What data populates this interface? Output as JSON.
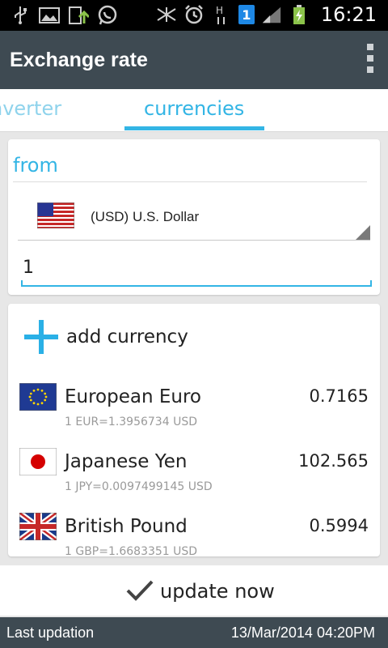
{
  "status_bar": {
    "time": "16:21",
    "sim_badge": "1",
    "icons": [
      "usb-icon",
      "image-icon",
      "upload-icon",
      "whatsapp-icon",
      "mute-icon",
      "alarm-icon",
      "network-h-icon",
      "sim-1-icon",
      "signal-icon",
      "battery-charging-icon"
    ]
  },
  "action_bar": {
    "title": "Exchange rate",
    "overflow_icon": "overflow-menu-icon"
  },
  "tabs": [
    {
      "label": "nverter",
      "selected": false
    },
    {
      "label": "currencies",
      "selected": true
    }
  ],
  "from_card": {
    "label": "from",
    "selected_currency": "(USD) U.S. Dollar",
    "amount": "1"
  },
  "list": {
    "add_label": "add currency",
    "currencies": [
      {
        "name": "European Euro",
        "rate": "1 EUR=1.3956734 USD",
        "value": "0.7165",
        "flag": "eu-flag"
      },
      {
        "name": "Japanese Yen",
        "rate": "1 JPY=0.0097499145 USD",
        "value": "102.565",
        "flag": "jp-flag"
      },
      {
        "name": "British Pound",
        "rate": "1 GBP=1.6683351 USD",
        "value": "0.5994",
        "flag": "gb-flag"
      }
    ]
  },
  "update": {
    "label": "update now"
  },
  "footer": {
    "label": "Last updation",
    "datetime": "13/Mar/2014 04:20PM"
  },
  "colors": {
    "accent": "#33b5e5",
    "action_bar": "#3e4a52",
    "background": "#e7e7e7"
  }
}
